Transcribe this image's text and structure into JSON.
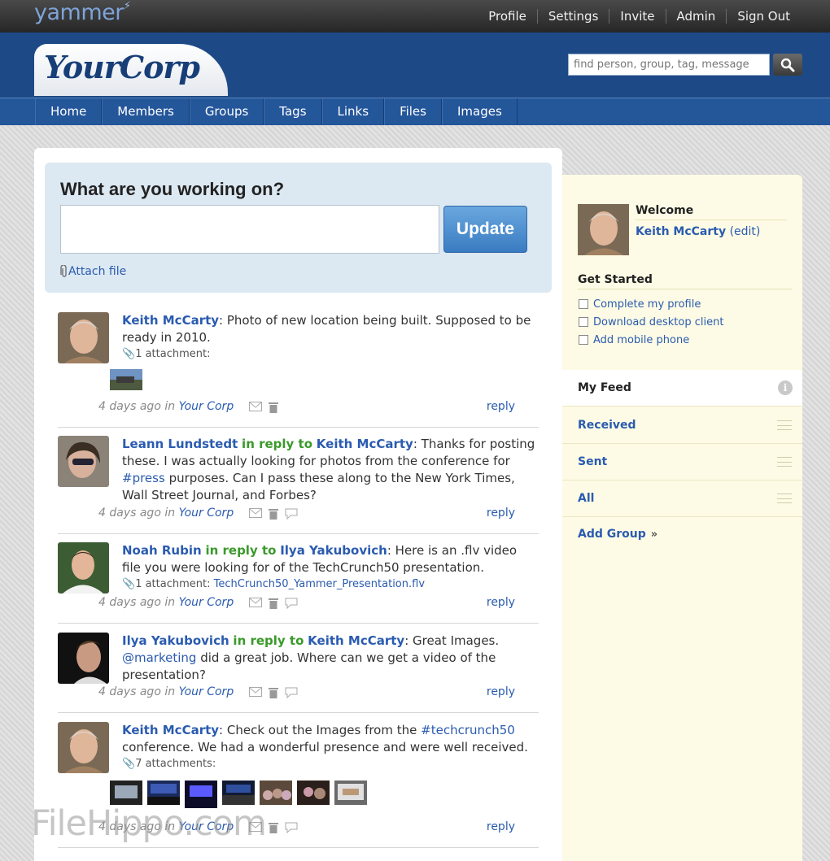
{
  "topbar": {
    "logo": "yammer",
    "links": [
      "Profile",
      "Settings",
      "Invite",
      "Admin",
      "Sign Out"
    ]
  },
  "header": {
    "corp_name": "YourCorp",
    "search_placeholder": "find person, group, tag, message",
    "search_icon": "magnifier-icon"
  },
  "nav": [
    "Home",
    "Members",
    "Groups",
    "Tags",
    "Links",
    "Files",
    "Images"
  ],
  "compose": {
    "title": "What are you working on?",
    "update_label": "Update",
    "attach_label": "Attach file"
  },
  "messages": [
    {
      "author": "Keith McCarty",
      "separator": ":",
      "text": " Photo of new location being built. Supposed to be ready in 2010.",
      "attachments": "1 attachment:",
      "time": "4 days ago in",
      "where": "Your Corp",
      "reply": "reply"
    },
    {
      "author": "Leann Lundstedt",
      "in_reply": "in reply to",
      "reply_to": "Keith McCarty",
      "separator": ":",
      "text_a": " Thanks for posting these. I was actually looking for photos from the conference for ",
      "tag": "#press",
      "text_b": " purposes. Can I pass these along to the New York Times, Wall Street Journal, and Forbes?",
      "time": "4 days ago in",
      "where": "Your Corp",
      "reply": "reply"
    },
    {
      "author": "Noah Rubin",
      "in_reply": "in reply to",
      "reply_to": "Ilya Yakubovich",
      "separator": ":",
      "text": " Here is an .flv video file you were looking for of the TechCrunch50 presentation.",
      "attachments": "1 attachment:",
      "file": "TechCrunch50_Yammer_Presentation.flv",
      "time": "4 days ago in",
      "where": "Your Corp",
      "reply": "reply"
    },
    {
      "author": "Ilya Yakubovich",
      "in_reply": "in reply to",
      "reply_to": "Keith McCarty",
      "separator": ":",
      "text_a": " Great Images. ",
      "tag": "@marketing",
      "text_b": " did a great job. Where can we get a video of the presentation?",
      "time": "4 days ago in",
      "where": "Your Corp",
      "reply": "reply"
    },
    {
      "author": "Keith McCarty",
      "separator": ":",
      "text_a": " Check out the Images from the ",
      "tag": "#techcrunch50",
      "text_b": " conference. We had a wonderful presence and were well received.",
      "attachments": "7 attachments:",
      "time": "4 days ago in",
      "where": "Your Corp",
      "reply": "reply"
    }
  ],
  "sidebar": {
    "welcome": "Welcome",
    "user_name": "Keith McCarty",
    "edit": "(edit)",
    "get_started": "Get Started",
    "tasks": [
      "Complete my profile",
      "Download desktop client",
      "Add mobile phone"
    ],
    "feeds": [
      "My Feed",
      "Received",
      "Sent",
      "All"
    ],
    "info_icon": "i",
    "add_group": "Add Group",
    "add_group_icon": "»"
  },
  "watermark": "FileHippo.com",
  "colors": {
    "header_blue": "#1d4a86",
    "nav_blue": "#24569a",
    "link_blue": "#2a5bb0",
    "reply_green": "#3a9a2a",
    "sidebar_bg": "#fdfbe5"
  }
}
